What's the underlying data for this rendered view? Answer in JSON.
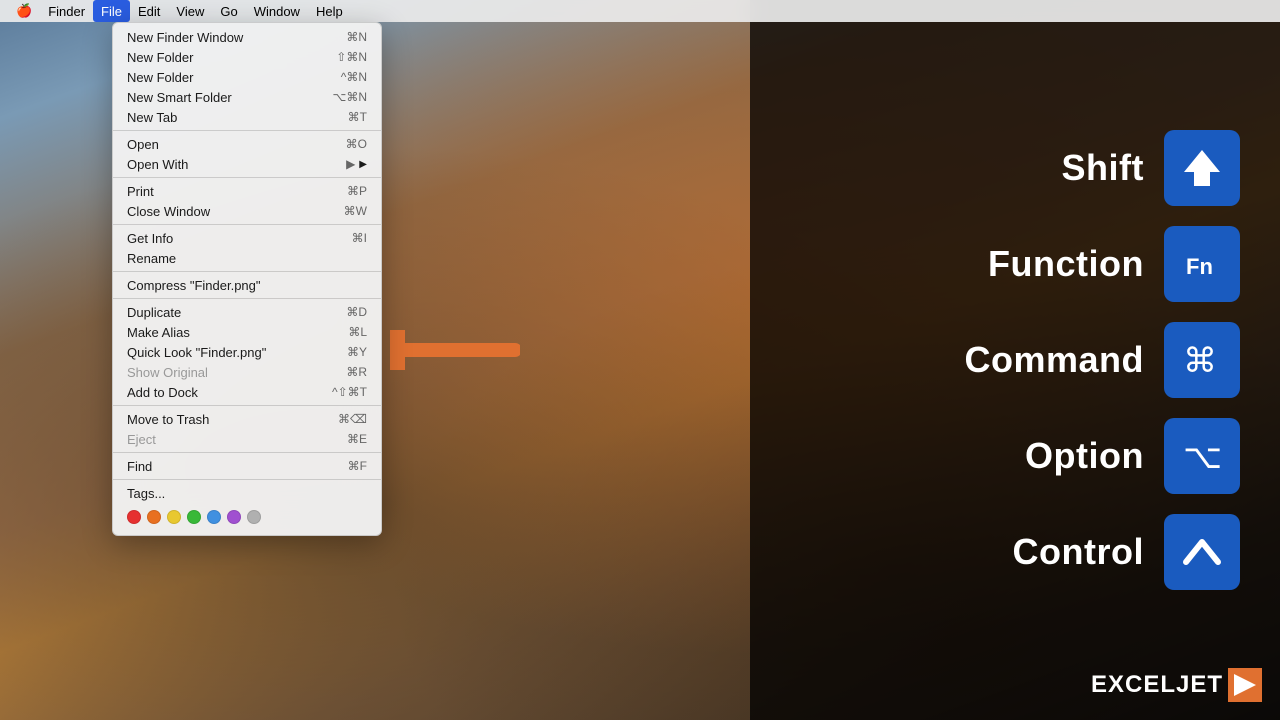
{
  "menubar": {
    "apple": "🍎",
    "items": [
      {
        "id": "finder",
        "label": "Finder",
        "active": false
      },
      {
        "id": "file",
        "label": "File",
        "active": true
      },
      {
        "id": "edit",
        "label": "Edit",
        "active": false
      },
      {
        "id": "view",
        "label": "View",
        "active": false
      },
      {
        "id": "go",
        "label": "Go",
        "active": false
      },
      {
        "id": "window",
        "label": "Window",
        "active": false
      },
      {
        "id": "help",
        "label": "Help",
        "active": false
      }
    ]
  },
  "dropdown": {
    "items": [
      {
        "id": "new-finder-window",
        "label": "New Finder Window",
        "shortcut": "⌘N",
        "disabled": false
      },
      {
        "id": "new-folder",
        "label": "New Folder",
        "shortcut": "⇧⌘N",
        "disabled": false
      },
      {
        "id": "new-folder-selection",
        "label": "New Folder",
        "shortcut": "^⌘N",
        "disabled": false
      },
      {
        "id": "new-smart-folder",
        "label": "New Smart Folder",
        "shortcut": "⌥⌘N",
        "disabled": false
      },
      {
        "id": "new-tab",
        "label": "New Tab",
        "shortcut": "⌘T",
        "disabled": false
      },
      {
        "sep1": true
      },
      {
        "id": "open",
        "label": "Open",
        "shortcut": "⌘O",
        "disabled": false
      },
      {
        "id": "open-with",
        "label": "Open With",
        "shortcut": "▶",
        "disabled": false,
        "submenu": true
      },
      {
        "sep2": true
      },
      {
        "id": "print",
        "label": "Print",
        "shortcut": "⌘P",
        "disabled": false
      },
      {
        "id": "close-window",
        "label": "Close Window",
        "shortcut": "⌘W",
        "disabled": false
      },
      {
        "sep3": true
      },
      {
        "id": "get-info",
        "label": "Get Info",
        "shortcut": "⌘I",
        "disabled": false
      },
      {
        "id": "rename",
        "label": "Rename",
        "shortcut": "",
        "disabled": false
      },
      {
        "sep4": true
      },
      {
        "id": "compress",
        "label": "Compress \"Finder.png\"",
        "shortcut": "",
        "disabled": false
      },
      {
        "sep5": true
      },
      {
        "id": "duplicate",
        "label": "Duplicate",
        "shortcut": "⌘D",
        "disabled": false
      },
      {
        "id": "make-alias",
        "label": "Make Alias",
        "shortcut": "⌘L",
        "disabled": false
      },
      {
        "id": "quick-look",
        "label": "Quick Look \"Finder.png\"",
        "shortcut": "⌘Y",
        "disabled": false
      },
      {
        "id": "show-original",
        "label": "Show Original",
        "shortcut": "⌘R",
        "disabled": true
      },
      {
        "id": "add-to-dock",
        "label": "Add to Dock",
        "shortcut": "^⇧⌘T",
        "disabled": false
      },
      {
        "sep6": true
      },
      {
        "id": "move-to-trash",
        "label": "Move to Trash",
        "shortcut": "⌘⌫",
        "disabled": false
      },
      {
        "id": "eject",
        "label": "Eject",
        "shortcut": "⌘E",
        "disabled": true
      },
      {
        "sep7": true
      },
      {
        "id": "find",
        "label": "Find",
        "shortcut": "⌘F",
        "disabled": false
      },
      {
        "sep8": true
      },
      {
        "id": "tags",
        "label": "Tags...",
        "shortcut": "",
        "disabled": false
      }
    ],
    "tags": [
      {
        "id": "tag-red",
        "color": "#e63030"
      },
      {
        "id": "tag-orange",
        "color": "#e87020"
      },
      {
        "id": "tag-yellow",
        "color": "#e8c830"
      },
      {
        "id": "tag-green",
        "color": "#38b838"
      },
      {
        "id": "tag-blue",
        "color": "#4090e0"
      },
      {
        "id": "tag-purple",
        "color": "#a050d0"
      },
      {
        "id": "tag-gray",
        "color": "#b0b0b0"
      }
    ]
  },
  "shortcuts": [
    {
      "id": "shift",
      "label": "Shift",
      "icon": "shift"
    },
    {
      "id": "function",
      "label": "Function",
      "icon": "fn"
    },
    {
      "id": "command",
      "label": "Command",
      "icon": "command"
    },
    {
      "id": "option",
      "label": "Option",
      "icon": "option"
    },
    {
      "id": "control",
      "label": "Control",
      "icon": "control"
    }
  ],
  "logo": {
    "text": "EXCELJET"
  }
}
